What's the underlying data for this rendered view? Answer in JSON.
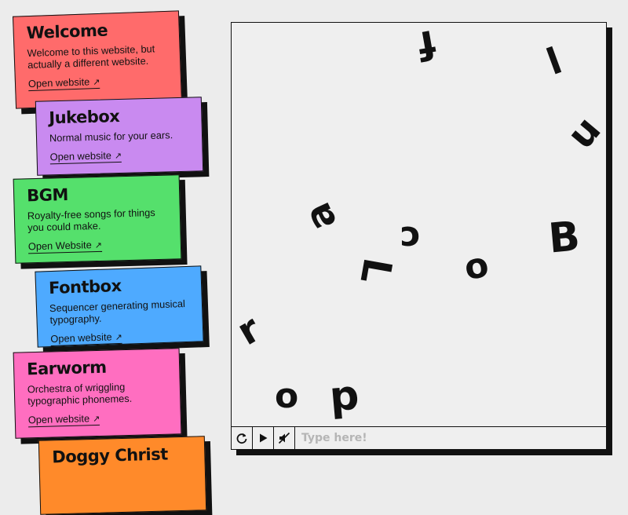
{
  "sites": [
    {
      "id": "welcome",
      "title": "Welcome",
      "description": "Welcome to this website, but actually a different website.",
      "link_label": "Open website",
      "color": "#ff6b6b"
    },
    {
      "id": "jukebox",
      "title": "Jukebox",
      "description": "Normal music for your ears.",
      "link_label": "Open website",
      "color": "#c98af0"
    },
    {
      "id": "bgm",
      "title": "BGM",
      "description": "Royalty-free songs for things you could make.",
      "link_label": "Open Website",
      "color": "#55e06c"
    },
    {
      "id": "fontbox",
      "title": "Fontbox",
      "description": "Sequencer generating musical typography.",
      "link_label": "Open website",
      "color": "#4eaaff"
    },
    {
      "id": "earworm",
      "title": "Earworm",
      "description": "Orchestra of wriggling typographic phonemes.",
      "link_label": "Open website",
      "color": "#ff6ec0"
    },
    {
      "id": "doggy",
      "title": "Doggy Christ",
      "description": "",
      "link_label": "",
      "color": "#ff8a2a"
    }
  ],
  "link_arrow": "↗",
  "player": {
    "glyphs": [
      "l",
      "f",
      "u",
      "a",
      "c",
      "B",
      "L",
      "o",
      "r",
      "o",
      "p"
    ],
    "controls": {
      "restart_icon": "restart-icon",
      "play_icon": "play-icon",
      "mute_icon": "mute-icon"
    },
    "input_placeholder": "Type here!",
    "input_value": ""
  }
}
